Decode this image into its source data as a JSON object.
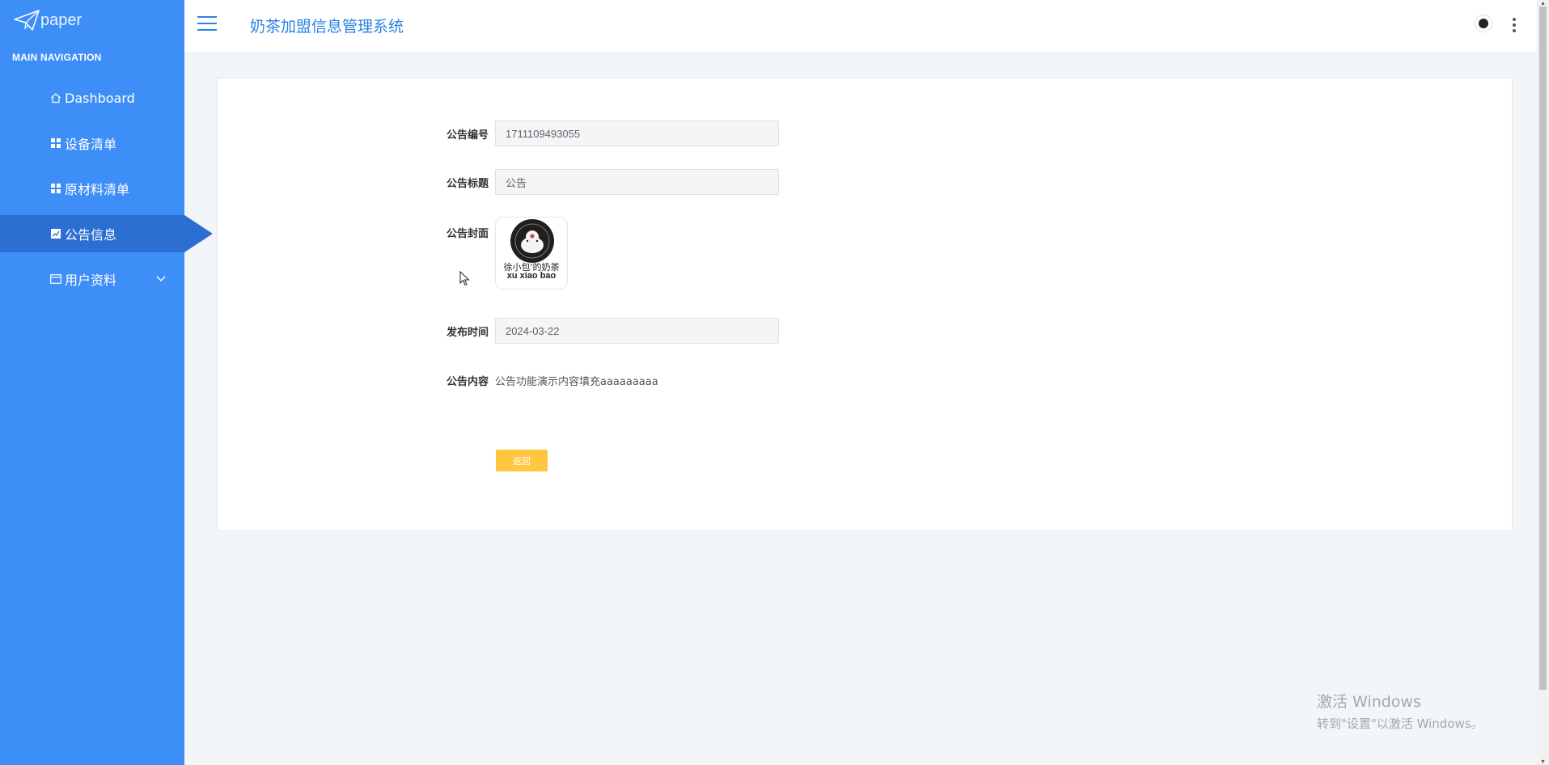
{
  "brand": {
    "name": "paper"
  },
  "sidebar": {
    "heading": "MAIN NAVIGATION",
    "items": [
      {
        "label": "Dashboard",
        "icon": "home-icon",
        "active": false
      },
      {
        "label": "设备清单",
        "icon": "grid-icon",
        "active": false
      },
      {
        "label": "原材料清单",
        "icon": "grid-icon",
        "active": false
      },
      {
        "label": "公告信息",
        "icon": "chart-icon",
        "active": true
      },
      {
        "label": "用户资料",
        "icon": "card-icon",
        "active": false,
        "expandable": true
      }
    ]
  },
  "header": {
    "title": "奶茶加盟信息管理系统"
  },
  "form": {
    "fields": [
      {
        "label": "公告编号",
        "value": "1711109493055"
      },
      {
        "label": "公告标题",
        "value": "公告"
      },
      {
        "label": "公告封面",
        "cover": {
          "line1": "徐小包'的奶茶",
          "line2": "xu xiao bao"
        }
      },
      {
        "label": "发布时间",
        "value": "2024-03-22"
      },
      {
        "label": "公告内容",
        "value": "公告功能演示内容填充aaaaaaaaa"
      }
    ],
    "back_button": "返回"
  },
  "watermark": {
    "line1": "激活 Windows",
    "line2": "转到\"设置\"以激活 Windows。"
  },
  "colors": {
    "sidebar": "#3e8ef7",
    "active": "#2c6fd3",
    "accent": "#2a82e4",
    "button": "#ffc740"
  }
}
